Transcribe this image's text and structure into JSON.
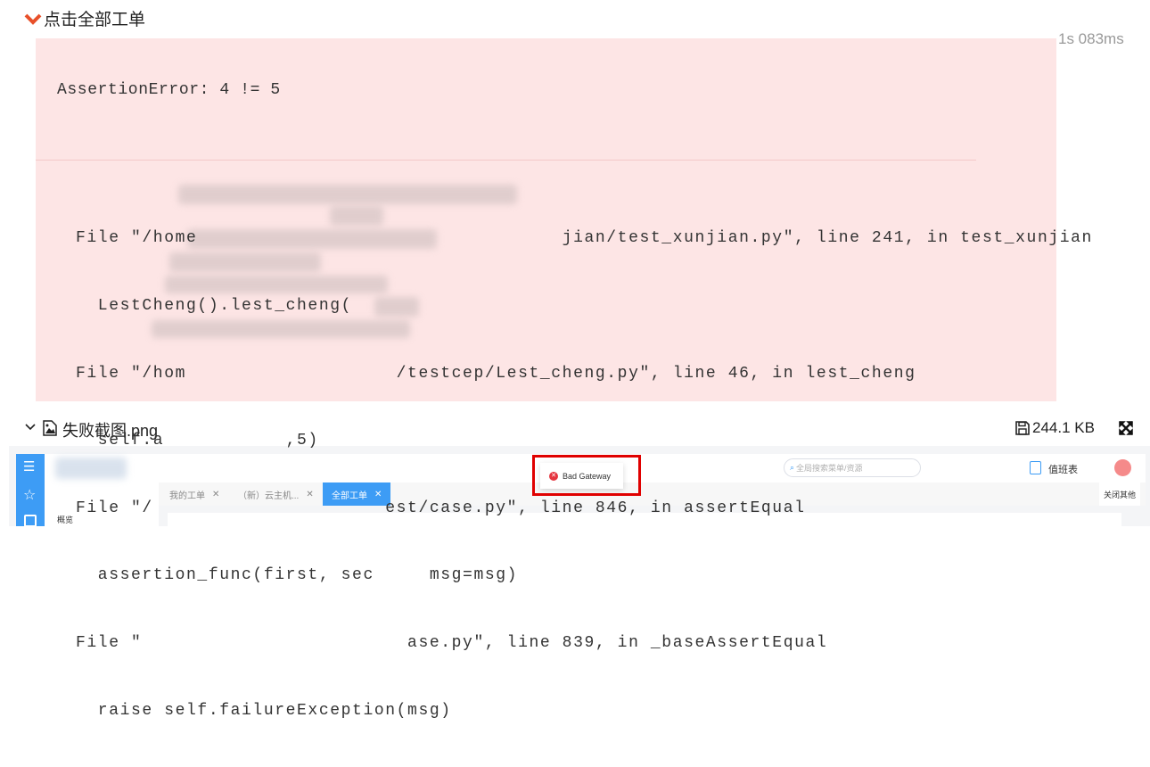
{
  "step": {
    "title": "点击全部工单",
    "duration": "1s 083ms",
    "accent": "#e8502a"
  },
  "error": {
    "message": "AssertionError: 4 != 5",
    "trace": [
      "File \"/home                                 jian/test_xunjian.py\", line 241, in test_xunjian",
      "  LestCheng().lest_cheng(     ",
      "File \"/hom                   /testcep/Lest_cheng.py\", line 46, in lest_cheng",
      "  self.a           ,5)",
      "File \"/                     est/case.py\", line 846, in assertEqual",
      "  assertion_func(first, sec     msg=msg)",
      "File \"                        ase.py\", line 839, in _baseAssertEqual",
      "  raise self.failureException(msg)"
    ],
    "background": "#fde5e5"
  },
  "attachment": {
    "name": "失败截图.png",
    "size": "244.1 KB"
  },
  "screenshot": {
    "tabs": [
      {
        "label": "我的工单",
        "active": false
      },
      {
        "label": "（新）云主机...",
        "active": false
      },
      {
        "label": "全部工单",
        "active": true
      }
    ],
    "close_others": "关闭其他",
    "search_placeholder": "全局搜索菜单/资源",
    "duty_label": "值班表",
    "menu_item": "概览",
    "toast": "Bad Gateway",
    "highlight_color": "#e00000",
    "brand_color": "#3d9cf5"
  }
}
